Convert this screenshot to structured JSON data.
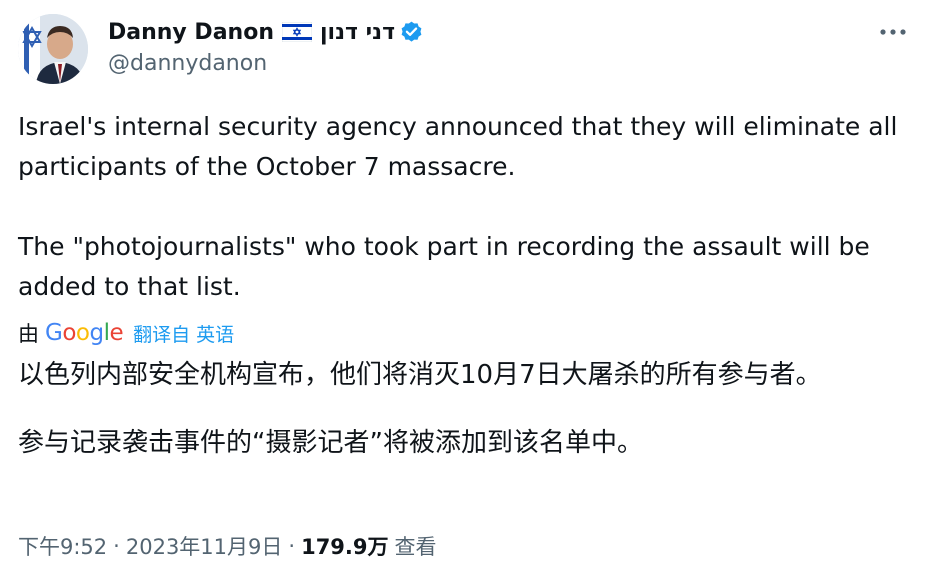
{
  "author": {
    "display_name": "Danny Danon",
    "hebrew_name": "דני דנון",
    "handle": "@dannydanon",
    "flag_icon": "israel-flag-icon",
    "verified_icon": "verified-badge-icon"
  },
  "menu": {
    "more_icon": "more-dots-icon"
  },
  "tweet": {
    "text_p1": "Israel's internal security agency announced that they will eliminate all participants of the October 7 massacre.",
    "text_p2": "The \"photojournalists\" who took part in recording the assault will be added to that list."
  },
  "translation": {
    "prefix": "由",
    "provider": "Google",
    "link": "翻译自 英语",
    "text_p1": "以色列内部安全机构宣布，他们将消灭10月7日大屠杀的所有参与者。",
    "text_p2": "参与记录袭击事件的“摄影记者”将被添加到该名单中。"
  },
  "meta": {
    "time": "下午9:52",
    "date": "2023年11月9日",
    "separator": "·",
    "views": "179.9万",
    "views_label": "查看"
  },
  "colors": {
    "text_primary": "#0f1419",
    "text_secondary": "#536471",
    "link_blue": "#1d9bf0",
    "verified_blue": "#1d9bf0",
    "google_blue": "#4285F4",
    "google_red": "#EA4335",
    "google_yellow": "#FBBC05",
    "google_green": "#34A853"
  }
}
